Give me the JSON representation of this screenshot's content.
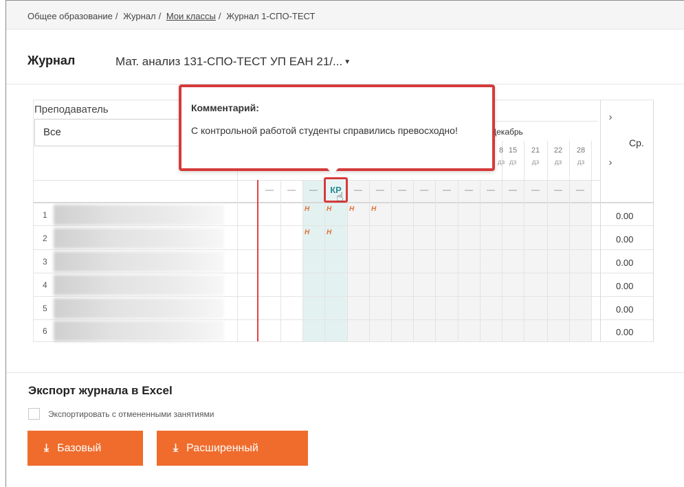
{
  "breadcrumb": {
    "items": [
      "Общее образование",
      "Журнал",
      "Мои классы",
      "Журнал 1-СПО-ТЕСТ"
    ],
    "separator": "/"
  },
  "header": {
    "title": "Журнал",
    "subject": "Мат. анализ 131-СПО-ТЕСТ УП ЕАН 21/..."
  },
  "filter": {
    "teacher_label": "Преподаватель",
    "teacher_value": "Все"
  },
  "grid": {
    "month": "Декабрь",
    "days": [
      {
        "num": "8",
        "type": "дз"
      },
      {
        "num": "15",
        "type": "дз"
      },
      {
        "num": "21",
        "type": "дз"
      },
      {
        "num": "22",
        "type": "дз"
      },
      {
        "num": "28",
        "type": "дз"
      }
    ],
    "avg_header": "Ср.",
    "selected_mark": "КР",
    "dash": "—",
    "absent_mark": "Н",
    "rows": [
      {
        "num": "1",
        "avg": "0.00"
      },
      {
        "num": "2",
        "avg": "0.00"
      },
      {
        "num": "3",
        "avg": "0.00"
      },
      {
        "num": "4",
        "avg": "0.00"
      },
      {
        "num": "5",
        "avg": "0.00"
      },
      {
        "num": "6",
        "avg": "0.00"
      }
    ]
  },
  "tooltip": {
    "title": "Комментарий:",
    "text": "С контрольной работой студенты справились превосходно!"
  },
  "export": {
    "title": "Экспорт журнала в Excel",
    "checkbox_label": "Экспортировать с отмененными занятиями",
    "basic_button": "Базовый",
    "extended_button": "Расширенный"
  },
  "colors": {
    "accent": "#f06c2c",
    "highlight_red": "#d63a3a",
    "teal_text": "#2a8c93",
    "absent": "#e0713a",
    "selected_column": "#e3f1f1"
  }
}
